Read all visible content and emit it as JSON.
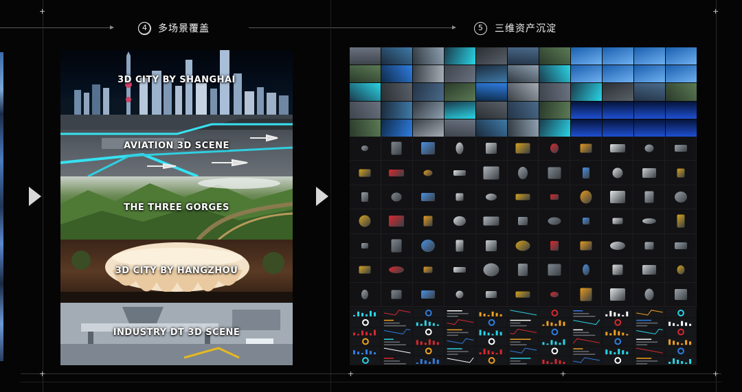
{
  "sections": [
    {
      "number": "④",
      "title": "多场景覆盖"
    },
    {
      "number": "⑤",
      "title": "三维资产沉淀"
    }
  ],
  "scenes": [
    {
      "label": "3D CITY BY SHANGHAI",
      "theme": "city-night"
    },
    {
      "label": "AVIATION 3D SCENE",
      "theme": "airport"
    },
    {
      "label": "THE THREE GORGES",
      "theme": "mountains"
    },
    {
      "label": "3D CITY BY HANGZHOU",
      "theme": "stadium"
    },
    {
      "label": "INDUSTRY DT 3D SCENE",
      "theme": "industry"
    }
  ],
  "asset_library": {
    "thumbnail_rows": 5,
    "thumbnail_cols": 11,
    "object_rows": 7,
    "object_cols": 11,
    "dashboard_rows": 6,
    "dashboard_cols": 11
  },
  "colors": {
    "background": "#050505",
    "accent_cyan": "#2ad4e6",
    "accent_red": "#d8282e",
    "accent_blue": "#2f7de1",
    "accent_orange": "#f0a020"
  }
}
